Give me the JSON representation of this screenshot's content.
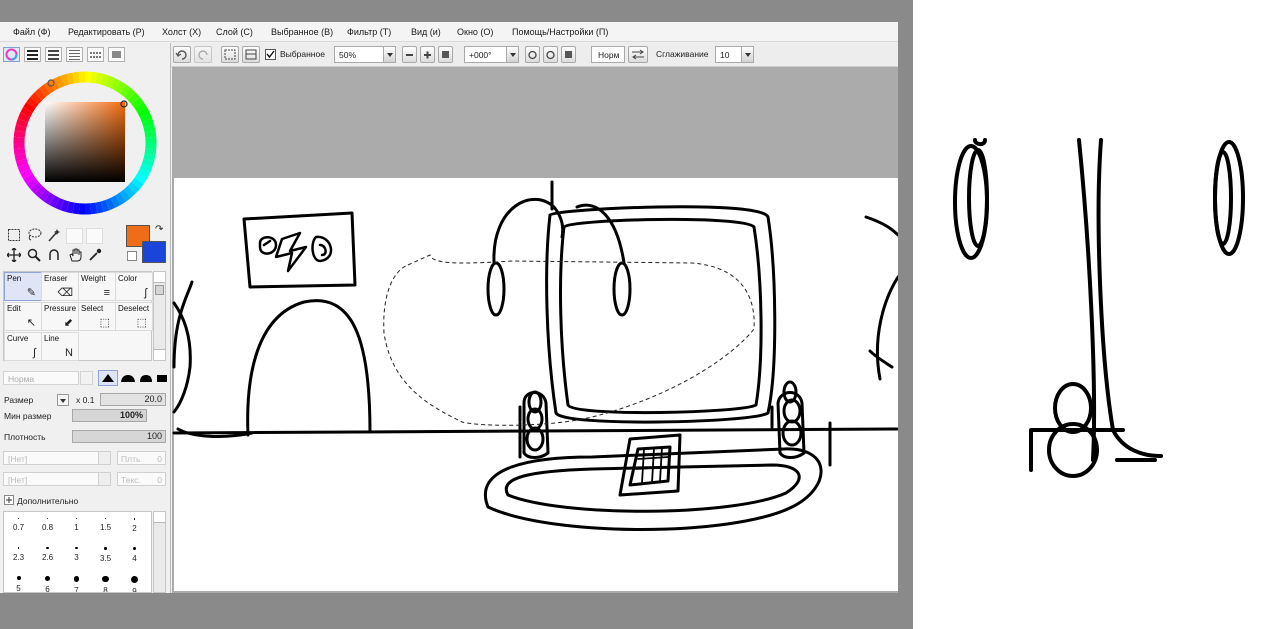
{
  "menu": [
    "Файл (Ф)",
    "Редактировать (Р)",
    "Холст (Х)",
    "Слой (С)",
    "Выбранное (В)",
    "Фильтр (Т)",
    "Вид (и)",
    "Окно (О)",
    "Помощь/Настройки (П)"
  ],
  "toolbar": {
    "selection_label": "Выбранное",
    "zoom_value": "50%",
    "rotation_value": "+000°",
    "blend_mode": "Норм",
    "smoothing_label": "Сглаживание",
    "smoothing_value": "10"
  },
  "colors": {
    "primary": "#f06d17",
    "secondary": "#1b44d8",
    "canvas_gray": "#ababab",
    "selection_highlight": "#dfe4f7"
  },
  "brushes": [
    {
      "label": "Pen",
      "icon": "pen-icon",
      "selected": true
    },
    {
      "label": "Eraser",
      "icon": "eraser-icon"
    },
    {
      "label": "Weight",
      "icon": "weight-icon"
    },
    {
      "label": "Color",
      "icon": "color-icon"
    },
    {
      "label": "Edit",
      "icon": "edit-icon"
    },
    {
      "label": "Pressure",
      "icon": "pressure-icon"
    },
    {
      "label": "Select",
      "icon": "select-icon"
    },
    {
      "label": "Deselect",
      "icon": "deselect-icon"
    },
    {
      "label": "Curve",
      "icon": "curve-icon"
    },
    {
      "label": "Line",
      "icon": "line-icon"
    }
  ],
  "brush_settings": {
    "blend_placeholder": "Норма",
    "size_label": "Размер",
    "size_multiplier": "x 0.1",
    "size_value": "20.0",
    "min_size_label": "Мин размер",
    "min_size_value": "100%",
    "density_label": "Плотность",
    "density_value": "100",
    "texture_none_1": "[Нет]",
    "texture_none_2": "[Нет]",
    "texture_strength_label": "Плть",
    "texture_strength_value": "0",
    "texture2_label": "Текс.",
    "texture2_value": "0",
    "advanced_label": "Дополнительно"
  },
  "dot_sizes_row1": [
    "0.7",
    "0.8",
    "1",
    "1.5",
    "2"
  ],
  "dot_sizes_row2": [
    "2.3",
    "2.6",
    "3",
    "3.5",
    "4"
  ],
  "dot_sizes_row3": [
    "5",
    "6",
    "7",
    "8",
    "9"
  ]
}
